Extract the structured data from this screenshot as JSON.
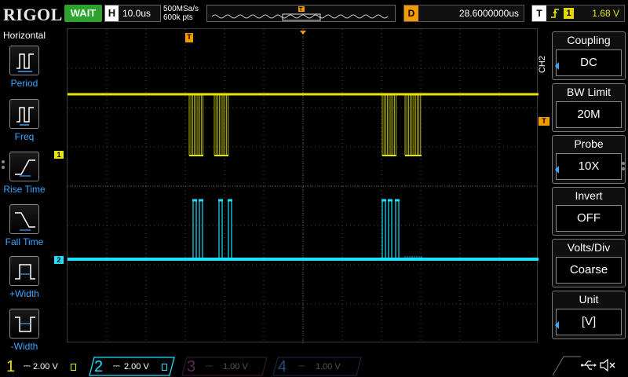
{
  "header": {
    "brand": "RIGOL",
    "run_status": "WAIT",
    "timebase_label": "H",
    "timebase_value": "10.0us",
    "sample_rate": "500MSa/s",
    "memory_depth": "600k pts",
    "delay_label": "D",
    "delay_value": "28.6000000us",
    "trigger_label": "T",
    "trigger_source": "1",
    "trigger_level": "1.68 V"
  },
  "left_menu": {
    "title": "Horizontal",
    "items": [
      {
        "label": "Period",
        "icon": "period-icon"
      },
      {
        "label": "Freq",
        "icon": "freq-icon"
      },
      {
        "label": "Rise Time",
        "icon": "rise-time-icon"
      },
      {
        "label": "Fall Time",
        "icon": "fall-time-icon"
      },
      {
        "label": "+Width",
        "icon": "pos-width-icon"
      },
      {
        "label": "-Width",
        "icon": "neg-width-icon"
      }
    ]
  },
  "grid_markers": {
    "ch1": "1",
    "ch2": "2",
    "trigger": "T"
  },
  "right_menu": {
    "channel": "CH2",
    "items": [
      {
        "title": "Coupling",
        "value": "DC"
      },
      {
        "title": "BW Limit",
        "value": "20M"
      },
      {
        "title": "Probe",
        "value": "10X"
      },
      {
        "title": "Invert",
        "value": "OFF"
      },
      {
        "title": "Volts/Div",
        "value": "Coarse"
      },
      {
        "title": "Unit",
        "value": "[V]"
      }
    ]
  },
  "channels": [
    {
      "num": "1",
      "scale": "2.00 V",
      "color": "#e6e600",
      "active": true
    },
    {
      "num": "2",
      "scale": "2.00 V",
      "color": "#1fe0ff",
      "active": true
    },
    {
      "num": "3",
      "scale": "1.00 V",
      "color": "#c000c0",
      "active": false
    },
    {
      "num": "4",
      "scale": "1.00 V",
      "color": "#3a6fd0",
      "active": false
    }
  ],
  "colors": {
    "ch1": "#e6e600",
    "ch2": "#1fe0ff",
    "trigger": "#f39a00",
    "accent": "#3aa8ff",
    "run_status_bg": "#2fa12f"
  }
}
